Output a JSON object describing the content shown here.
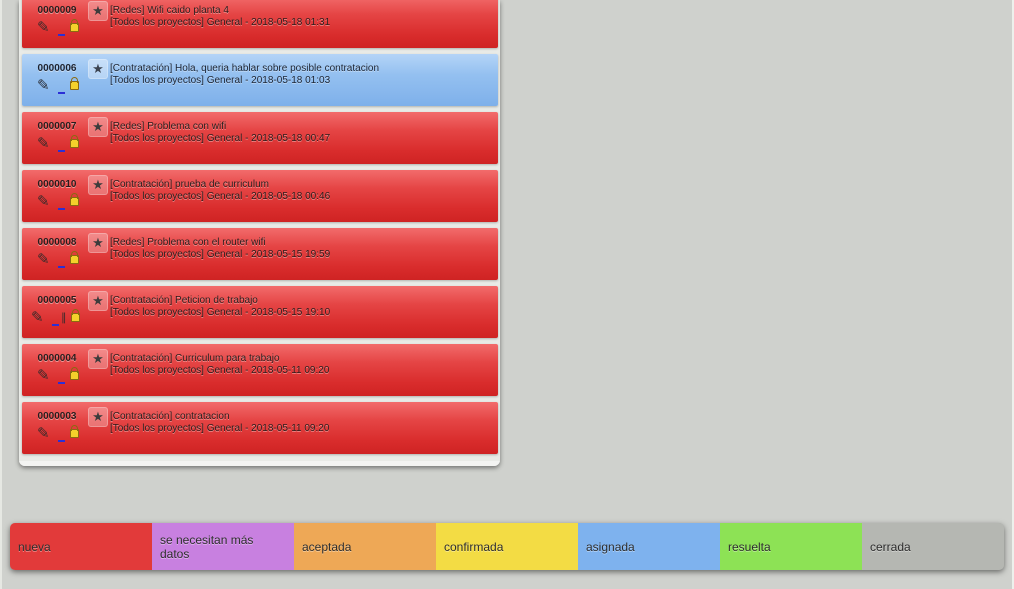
{
  "issues": [
    {
      "id": "0000009",
      "title": "[Redes] Wifi caido planta 4",
      "meta": "[Todos los proyectos] General - 2018-05-18 01:31",
      "color": "#e23a3a",
      "attachment": false
    },
    {
      "id": "0000006",
      "title": "[Contratación] Hola, queria hablar sobre posible contratacion",
      "meta": "[Todos los proyectos] General - 2018-05-18 01:03",
      "color": "#8ebcf0",
      "attachment": false
    },
    {
      "id": "0000007",
      "title": "[Redes] Problema con wifi",
      "meta": "[Todos los proyectos] General - 2018-05-18 00:47",
      "color": "#e23a3a",
      "attachment": false
    },
    {
      "id": "0000010",
      "title": "[Contratación] prueba de curriculum",
      "meta": "[Todos los proyectos] General - 2018-05-18 00:46",
      "color": "#e23a3a",
      "attachment": false
    },
    {
      "id": "0000008",
      "title": "[Redes] Problema con el router wifi",
      "meta": "[Todos los proyectos] General - 2018-05-15 19:59",
      "color": "#e23a3a",
      "attachment": false
    },
    {
      "id": "0000005",
      "title": "[Contratación] Peticion de trabajo",
      "meta": "[Todos los proyectos] General - 2018-05-15 19:10",
      "color": "#e23a3a",
      "attachment": true
    },
    {
      "id": "0000004",
      "title": "[Contratación] Curriculum para trabajo",
      "meta": "[Todos los proyectos] General - 2018-05-11 09:20",
      "color": "#e23a3a",
      "attachment": false
    },
    {
      "id": "0000003",
      "title": "[Contratación] contratacion",
      "meta": "[Todos los proyectos] General - 2018-05-11 09:20",
      "color": "#e23a3a",
      "attachment": false
    }
  ],
  "icons": {
    "edit": "pencil-icon",
    "star": "star-icon",
    "lock": "lock-icon",
    "attachment": "paperclip-icon"
  },
  "legend": [
    {
      "label": "nueva",
      "color": "#e23a3a"
    },
    {
      "label": "se necesitan más datos",
      "color": "#c880e0"
    },
    {
      "label": "aceptada",
      "color": "#eea856"
    },
    {
      "label": "confirmada",
      "color": "#f3dc44"
    },
    {
      "label": "asignada",
      "color": "#7eb2ee"
    },
    {
      "label": "resuelta",
      "color": "#8de255"
    },
    {
      "label": "cerrada",
      "color": "#b5b7b2"
    }
  ]
}
